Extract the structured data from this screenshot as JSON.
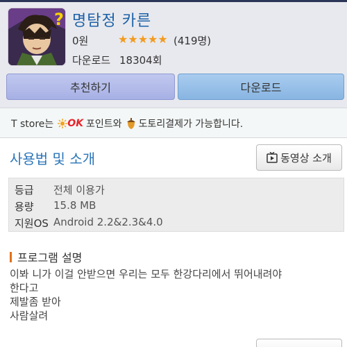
{
  "app": {
    "title": "명탐정 카른",
    "price": "0원",
    "stars": "★★★★★",
    "rating_count": "(419명)",
    "download_label": "다운로드",
    "download_count": "18304회"
  },
  "buttons": {
    "recommend": "추천하기",
    "download": "다운로드"
  },
  "tstore": {
    "prefix": "T store는",
    "ok_text": "OK",
    "point_text": "포인트와",
    "acorn_text": "도토리결제가 가능합니다."
  },
  "usage": {
    "title": "사용법 및 소개",
    "video_button": "동영상 소개"
  },
  "info": {
    "grade_key": "등급",
    "grade_val": "전체 이용가",
    "size_key": "용량",
    "size_val": "15.8 MB",
    "os_key": "지원OS",
    "os_val": "Android 2.2&2.3&4.0"
  },
  "description": {
    "heading": "프로그램 설명",
    "lines": [
      "이봐 니가 이걸 안받으면 우리는 모두 한강다리에서 뛰어내려야",
      "한다고",
      "제발좀 받아",
      "사람살려"
    ]
  },
  "colors": {
    "title_blue": "#1b61a8",
    "section_blue": "#2a75b9",
    "star_orange": "#f39a1e",
    "ok_red": "#e8232a"
  }
}
